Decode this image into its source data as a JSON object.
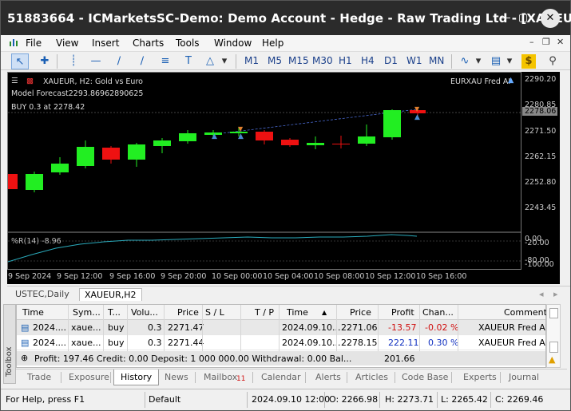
{
  "window": {
    "title": "51883664 - ICMarketsSC-Demo: Demo Account - Hedge - Raw Trading Ltd - [XAUEU...",
    "min_icon": "minimize-icon",
    "max_icon": "maximize-icon",
    "close_icon": "close-icon"
  },
  "menu": [
    "File",
    "View",
    "Insert",
    "Charts",
    "Tools",
    "Window",
    "Help"
  ],
  "toolbar": {
    "timeframes": [
      "M1",
      "M5",
      "M15",
      "M30",
      "H1",
      "H4",
      "D1",
      "W1",
      "MN"
    ]
  },
  "chart": {
    "symbol_line": "XAUEUR, H2:  Gold vs Euro",
    "forecast_line": "Model Forecast2293.86962890625",
    "trade_line": "BUY 0.3 at 2278.42",
    "ea_label": "EURXAU Fred AI",
    "indicator_label": "%R(14) -8.96",
    "current_price": "2278.06",
    "price_levels": [
      "2290.20",
      "2280.85",
      "2271.50",
      "2262.15",
      "2252.80",
      "2243.45",
      "0.00",
      "-20.00",
      "-80.00",
      "-100.00"
    ],
    "time_labels": [
      "9 Sep 2024",
      "9 Sep 12:00",
      "9 Sep 16:00",
      "9 Sep 20:00",
      "10 Sep 00:00",
      "10 Sep 04:00",
      "10 Sep 08:00",
      "10 Sep 12:00",
      "10 Sep 16:00"
    ],
    "colors": {
      "bull": "#22ee22",
      "bear": "#ee1111",
      "background": "#000000"
    }
  },
  "chart_tabs": [
    "USTEC,Daily",
    "XAUEUR,H2"
  ],
  "terminal": {
    "columns": [
      "Time",
      "Sym...",
      "T...",
      "Volu...",
      "Price",
      "S / L",
      "T / P",
      "Time",
      "Price",
      "Profit",
      "Chan...",
      "Comment"
    ],
    "rows": [
      {
        "time": "2024....",
        "symbol": "xaue...",
        "type": "buy",
        "volume": "0.3",
        "price": "2271.47",
        "sl": "",
        "tp": "",
        "close_time": "2024.09.10...",
        "close_price": "2271.06",
        "profit": "-13.57",
        "change": "-0.02 %",
        "comment": "XAUEUR Fred AI"
      },
      {
        "time": "2024....",
        "symbol": "xaue...",
        "type": "buy",
        "volume": "0.3",
        "price": "2271.44",
        "sl": "",
        "tp": "",
        "close_time": "2024.09.10...",
        "close_price": "2278.15",
        "profit": "222.11",
        "change": "0.30 %",
        "comment": "XAUEUR Fred AI"
      }
    ],
    "summary": "Profit: 197.46  Credit: 0.00  Deposit: 1 000 000.00  Withdrawal: 0.00  Bal...",
    "summary_total": "201.66",
    "toolbox_label": "Toolbox"
  },
  "bottom_tabs": [
    "Trade",
    "Exposure",
    "History",
    "News",
    "Mailbox",
    "Calendar",
    "Alerts",
    "Articles",
    "Code Base",
    "Experts",
    "Journal"
  ],
  "mailbox_count": "11",
  "status": {
    "help": "For Help, press F1",
    "profile": "Default",
    "datetime": "2024.09.10 12:00",
    "open": "O: 2266.98",
    "high": "H: 2273.71",
    "low": "L: 2265.42",
    "close": "C: 2269.46"
  }
}
